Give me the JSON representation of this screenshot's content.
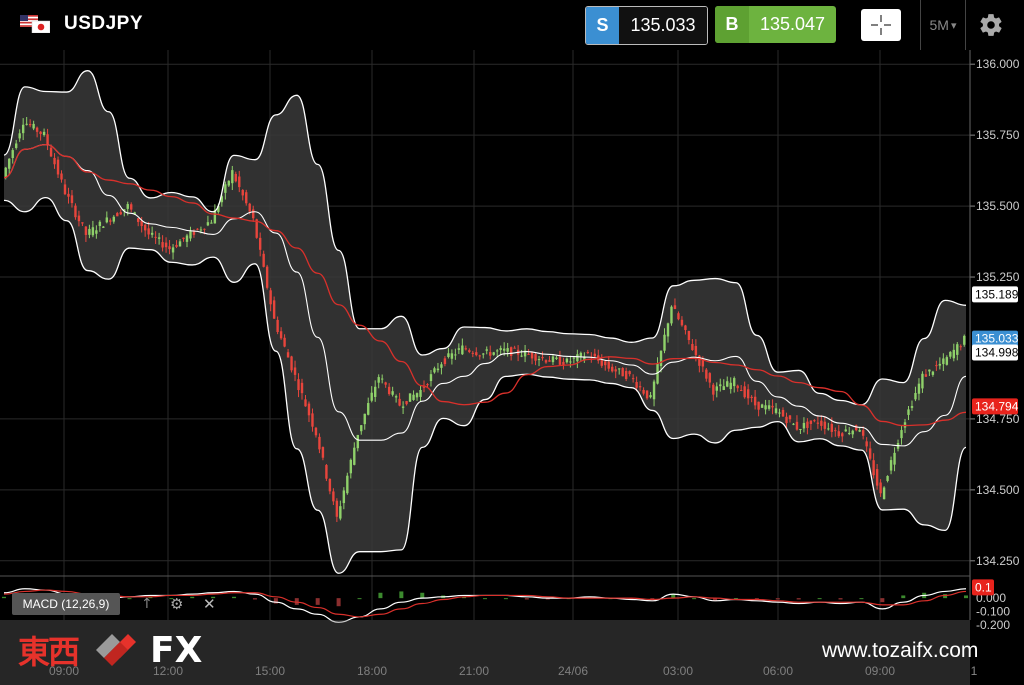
{
  "header": {
    "symbol": "USDJPY",
    "sell_tag": "S",
    "sell_price": "135.033",
    "buy_tag": "B",
    "buy_price": "135.047",
    "timeframe": "5M",
    "timeframe_arrow": "▾",
    "icons": [
      "us-jp-flag-icon",
      "crosshair-icon",
      "gear-icon"
    ]
  },
  "chart_data": {
    "type": "candlestick",
    "y_ticks": [
      "136.000",
      "135.750",
      "135.500",
      "135.250",
      "134.750",
      "134.500",
      "134.250"
    ],
    "y_range": [
      134.2,
      136.05
    ],
    "x_ticks": [
      "09:00",
      "12:00",
      "15:00",
      "18:00",
      "21:00",
      "24/06",
      "03:00",
      "06:00",
      "09:00",
      "1"
    ],
    "price_tags": [
      {
        "label": "135.189",
        "color": "#ffffff",
        "text_color": "#000000"
      },
      {
        "label": "135.033",
        "color": "#3b8fd2",
        "text_color": "#ffffff"
      },
      {
        "label": "134.998",
        "color": "#ffffff",
        "text_color": "#000000"
      },
      {
        "label": "134.794",
        "color": "#e8231c",
        "text_color": "#ffffff"
      }
    ],
    "indicators": [
      "Bollinger Bands",
      "Moving Average"
    ],
    "close_series": [
      135.6,
      135.8,
      135.75,
      135.55,
      135.4,
      135.45,
      135.5,
      135.4,
      135.35,
      135.4,
      135.45,
      135.62,
      135.45,
      135.1,
      134.9,
      134.7,
      134.4,
      134.7,
      134.9,
      134.8,
      134.85,
      134.95,
      135.0,
      134.98,
      134.99,
      134.98,
      134.96,
      134.95,
      134.98,
      134.93,
      134.9,
      134.82,
      135.15,
      135.0,
      134.85,
      134.88,
      134.8,
      134.78,
      134.72,
      134.74,
      134.7,
      134.72,
      134.48,
      134.72,
      134.9,
      134.95,
      135.03
    ],
    "macd": {
      "label": "MACD (12,26,9)",
      "y_ticks": [
        "0.000",
        "-0.100",
        "-0.200"
      ],
      "y_range": [
        -0.2,
        0.15
      ],
      "tag": {
        "label": "0.1",
        "color": "#e8231c"
      },
      "macd_series": [
        0.04,
        0.07,
        0.06,
        0.03,
        0.01,
        0.0,
        0.01,
        0.02,
        0.02,
        0.03,
        0.04,
        0.05,
        0.03,
        -0.03,
        -0.08,
        -0.12,
        -0.18,
        -0.14,
        -0.08,
        -0.03,
        0.0,
        0.01,
        0.02,
        0.02,
        0.02,
        0.01,
        0.0,
        0.0,
        0.01,
        0.0,
        -0.01,
        -0.02,
        0.03,
        0.01,
        -0.02,
        -0.01,
        -0.02,
        -0.03,
        -0.04,
        -0.03,
        -0.04,
        -0.03,
        -0.08,
        -0.03,
        0.02,
        0.05,
        0.07
      ],
      "signal_series": [
        0.03,
        0.05,
        0.06,
        0.05,
        0.03,
        0.02,
        0.01,
        0.01,
        0.02,
        0.02,
        0.03,
        0.04,
        0.04,
        0.01,
        -0.03,
        -0.07,
        -0.12,
        -0.14,
        -0.12,
        -0.08,
        -0.04,
        -0.01,
        0.01,
        0.02,
        0.02,
        0.02,
        0.01,
        0.0,
        0.0,
        0.0,
        0.0,
        -0.01,
        0.0,
        0.01,
        0.0,
        -0.01,
        -0.01,
        -0.02,
        -0.03,
        -0.03,
        -0.03,
        -0.03,
        -0.05,
        -0.05,
        -0.02,
        0.02,
        0.05
      ]
    }
  },
  "branding": {
    "logo_kanji": "東西",
    "logo_fx": "FX",
    "site": "www.tozaifx.com"
  },
  "colors": {
    "background": "#000000",
    "sell": "#3b8fd2",
    "buy": "#6db33f",
    "up_candle": "#8fd16a",
    "down_candle": "#e8453c",
    "bands": "#ffffff",
    "ma_line": "#d9302b"
  }
}
